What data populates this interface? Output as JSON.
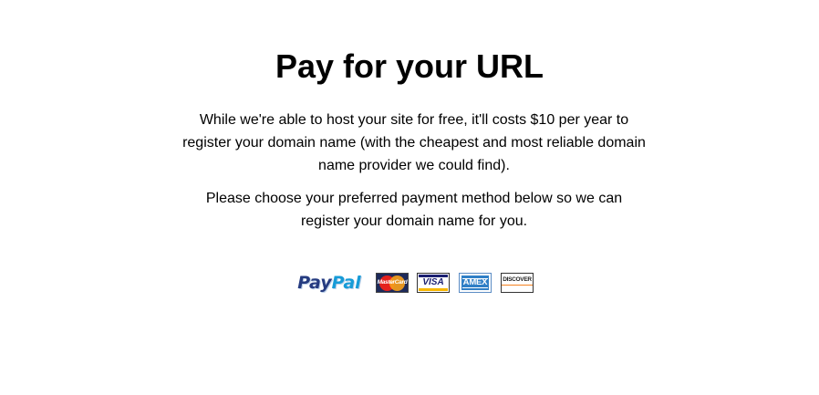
{
  "page": {
    "title": "Pay for your URL",
    "paragraph_1": "While we're able to host your site for free, it'll costs $10 per year to register your domain name (with the cheapest and most reliable domain name provider we could find).",
    "paragraph_2": "Please choose your preferred payment method below so we can register your domain name for you."
  },
  "payment_methods": {
    "paypal": {
      "label_part_1": "Pay",
      "label_part_2": "Pal",
      "icon": "paypal-logo"
    },
    "mastercard": {
      "label": "MasterCard",
      "icon": "mastercard-logo"
    },
    "visa": {
      "label": "VISA",
      "icon": "visa-logo"
    },
    "amex": {
      "label": "AMEX",
      "icon": "amex-logo"
    },
    "discover": {
      "label": "DISCOVER",
      "icon": "discover-logo"
    }
  },
  "colors": {
    "background": "#ffffff",
    "text": "#000000",
    "paypal_dark": "#253b80",
    "paypal_light": "#179bd7",
    "visa_blue": "#1a1f71",
    "amex_blue": "#2f7fc6",
    "mastercard_red": "#e5211d",
    "mastercard_orange": "#f59e1b",
    "discover_orange": "#f58220"
  }
}
